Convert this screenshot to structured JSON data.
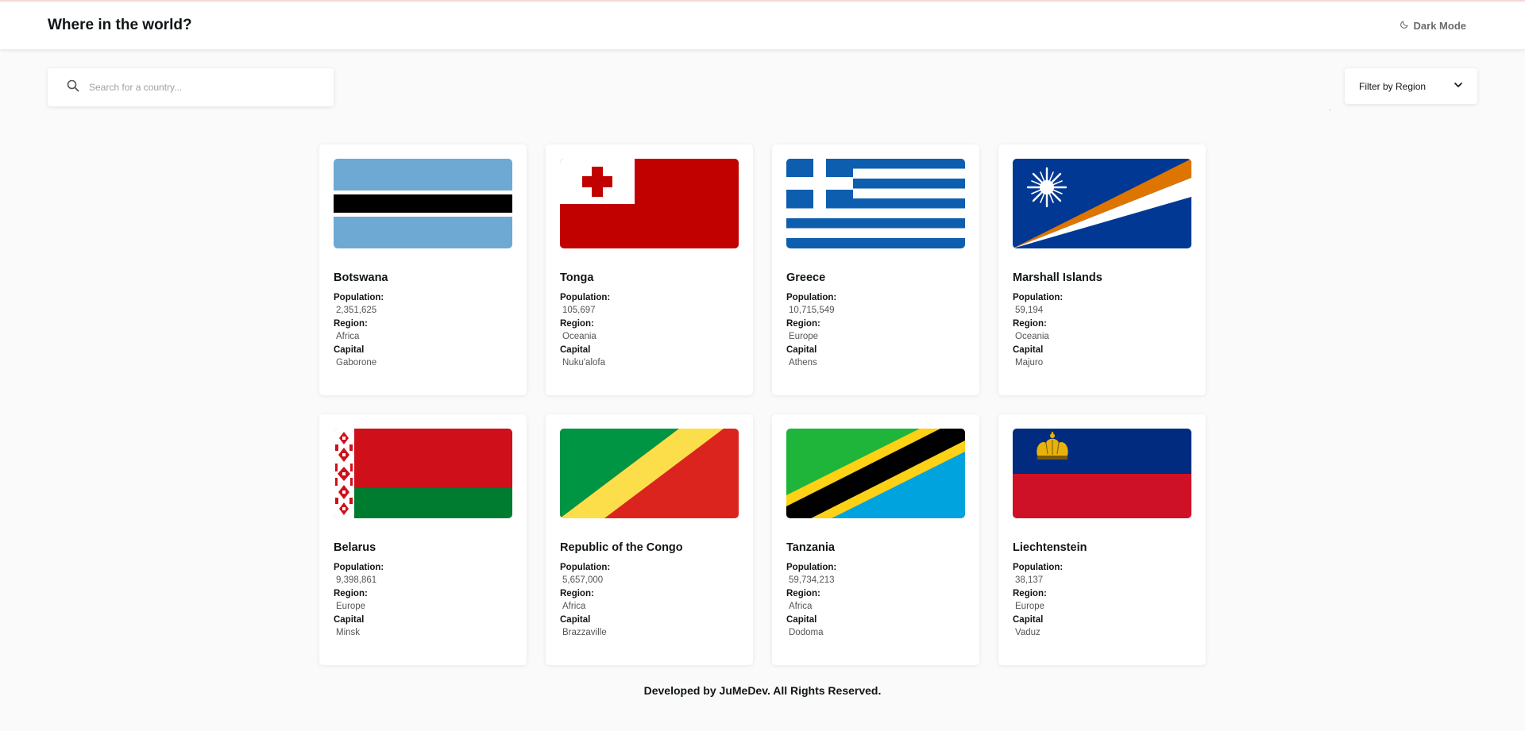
{
  "header": {
    "title": "Where in the world?",
    "dark_mode_label": "Dark Mode",
    "dark_mode_icon": "moon-icon"
  },
  "search": {
    "placeholder": "Search for a country...",
    "value": "",
    "icon": "search-icon"
  },
  "filter": {
    "label": "Filter by Region",
    "icon": "chevron-down-icon"
  },
  "labels": {
    "population": "Population:",
    "region": "Region:",
    "capital": "Capital"
  },
  "countries": [
    {
      "name": "Botswana",
      "population": "2,351,625",
      "region": "Africa",
      "capital": "Gaborone",
      "flag": "botswana-flag"
    },
    {
      "name": "Tonga",
      "population": "105,697",
      "region": "Oceania",
      "capital": "Nuku'alofa",
      "flag": "tonga-flag"
    },
    {
      "name": "Greece",
      "population": "10,715,549",
      "region": "Europe",
      "capital": "Athens",
      "flag": "greece-flag"
    },
    {
      "name": "Marshall Islands",
      "population": "59,194",
      "region": "Oceania",
      "capital": "Majuro",
      "flag": "marshall-islands-flag"
    },
    {
      "name": "Belarus",
      "population": "9,398,861",
      "region": "Europe",
      "capital": "Minsk",
      "flag": "belarus-flag"
    },
    {
      "name": "Republic of the Congo",
      "population": "5,657,000",
      "region": "Africa",
      "capital": "Brazzaville",
      "flag": "congo-flag"
    },
    {
      "name": "Tanzania",
      "population": "59,734,213",
      "region": "Africa",
      "capital": "Dodoma",
      "flag": "tanzania-flag"
    },
    {
      "name": "Liechtenstein",
      "population": "38,137",
      "region": "Europe",
      "capital": "Vaduz",
      "flag": "liechtenstein-flag"
    }
  ],
  "footer": {
    "text": "Developed by JuMeDev. All Rights Reserved."
  },
  "colors": {
    "background": "#fafafa",
    "surface": "#ffffff",
    "text": "#111517",
    "muted": "#555555"
  }
}
